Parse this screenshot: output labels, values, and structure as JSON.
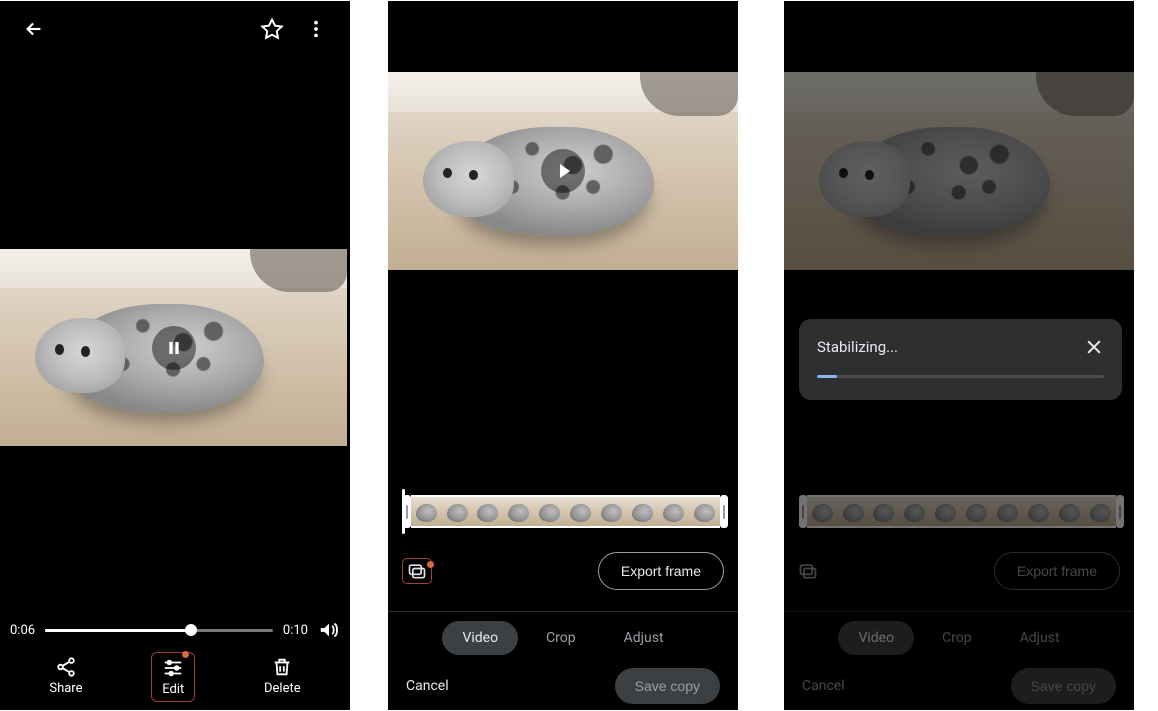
{
  "viewer": {
    "currentTime": "0:06",
    "totalTime": "0:10",
    "progressPercent": 64,
    "actions": {
      "share": "Share",
      "edit": "Edit",
      "delete": "Delete"
    }
  },
  "editor": {
    "exportFrame": "Export frame",
    "tabs": {
      "video": "Video",
      "crop": "Crop",
      "adjust": "Adjust"
    },
    "cancel": "Cancel",
    "saveCopy": "Save copy"
  },
  "stabilize": {
    "title": "Stabilizing...",
    "progressPercent": 7,
    "exportFrame": "Export frame",
    "tabs": {
      "video": "Video",
      "crop": "Crop",
      "adjust": "Adjust"
    },
    "cancel": "Cancel",
    "saveCopy": "Save copy"
  }
}
